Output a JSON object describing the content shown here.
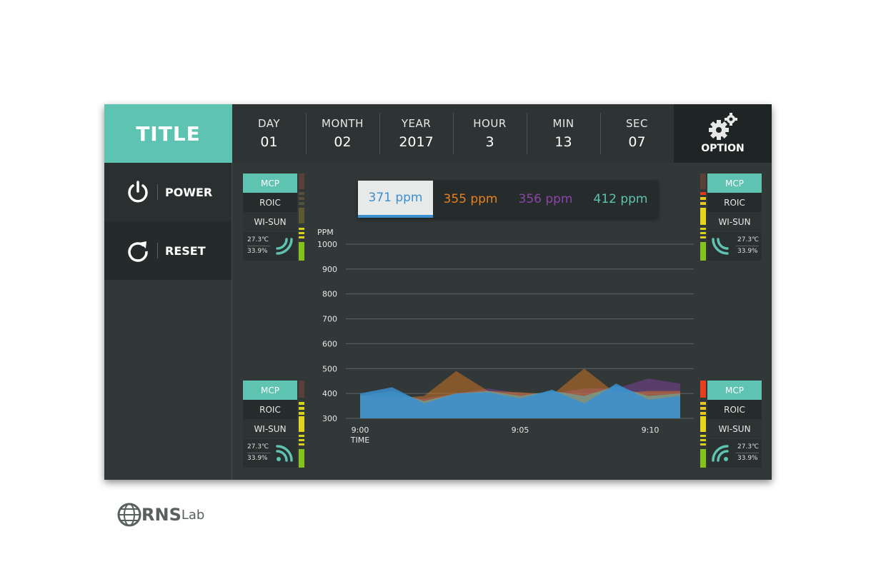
{
  "header": {
    "title": "TITLE",
    "date": [
      {
        "label": "DAY",
        "value": "01"
      },
      {
        "label": "MONTH",
        "value": "02"
      },
      {
        "label": "YEAR",
        "value": "2017"
      },
      {
        "label": "HOUR",
        "value": "3"
      },
      {
        "label": "MIN",
        "value": "13"
      },
      {
        "label": "SEC",
        "value": "07"
      }
    ],
    "option_label": "OPTION"
  },
  "sidebar": {
    "power_label": "POWER",
    "reset_label": "RESET"
  },
  "logo": {
    "main": "RNS",
    "sub": "Lab"
  },
  "sensors": [
    {
      "mcp": "MCP",
      "roic": "ROIC",
      "wisun": "WI-SUN",
      "temp": "27.3℃",
      "humidity": "33.9%"
    },
    {
      "mcp": "MCP",
      "roic": "ROIC",
      "wisun": "WI-SUN",
      "temp": "27.3℃",
      "humidity": "33.9%"
    },
    {
      "mcp": "MCP",
      "roic": "ROIC",
      "wisun": "WI-SUN",
      "temp": "27.3℃",
      "humidity": "33.9%"
    },
    {
      "mcp": "MCP",
      "roic": "ROIC",
      "wisun": "WI-SUN",
      "temp": "27.3℃",
      "humidity": "33.9%"
    }
  ],
  "ppm_tabs": [
    {
      "label": "371 ppm",
      "color": "#3a8fd0"
    },
    {
      "label": "355 ppm",
      "color": "#e8801e"
    },
    {
      "label": "356 ppm",
      "color": "#8a45a8"
    },
    {
      "label": "412 ppm",
      "color": "#5fc3b2"
    }
  ],
  "colors": {
    "accent": "#5fc3b2",
    "panel": "#323838"
  },
  "chart_data": {
    "type": "area",
    "ylabel": "PPM",
    "xlabel": "TIME",
    "ylim": [
      300,
      1000
    ],
    "yticks": [
      300,
      400,
      500,
      600,
      700,
      800,
      900,
      1000
    ],
    "x_tick_labels": [
      "9:00",
      "9:05",
      "9:10"
    ],
    "x": [
      0,
      1,
      2,
      3,
      4,
      5,
      6,
      7,
      8,
      9,
      10
    ],
    "grid": true,
    "series": [
      {
        "color": "#8a45a8",
        "values": [
          395,
          390,
          380,
          400,
          420,
          400,
          400,
          420,
          420,
          460,
          440
        ]
      },
      {
        "color": "#e8801e",
        "values": [
          395,
          380,
          390,
          490,
          410,
          405,
          395,
          500,
          400,
          410,
          410
        ]
      },
      {
        "color": "#5fc3b2",
        "values": [
          390,
          410,
          370,
          400,
          410,
          390,
          410,
          390,
          430,
          390,
          400
        ]
      },
      {
        "color": "#3a8fd0",
        "values": [
          400,
          425,
          360,
          400,
          405,
          380,
          415,
          360,
          440,
          375,
          390
        ]
      }
    ]
  }
}
